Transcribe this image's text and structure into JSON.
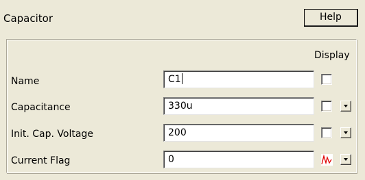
{
  "window": {
    "title": "Capacitor",
    "help_label": "Help"
  },
  "panel": {
    "display_header": "Display",
    "rows": [
      {
        "label": "Name",
        "value": "C1",
        "display_checked": false,
        "has_dropdown": false
      },
      {
        "label": "Capacitance",
        "value": "330u",
        "display_checked": false,
        "has_dropdown": true
      },
      {
        "label": "Init. Cap. Voltage",
        "value": "200",
        "display_checked": false,
        "has_dropdown": true
      },
      {
        "label": "Current Flag",
        "value": "0",
        "display_icon": "waveform-icon",
        "has_dropdown": true
      }
    ]
  },
  "colors": {
    "background": "#ece9d8",
    "waveform": "#e00000"
  }
}
